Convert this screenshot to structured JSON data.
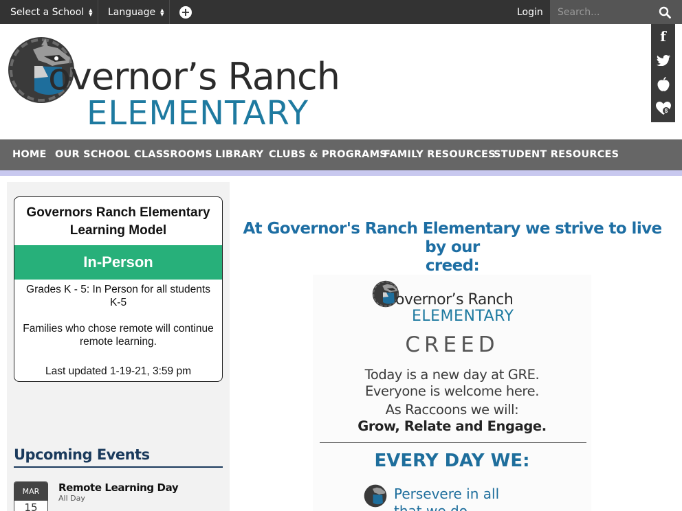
{
  "topbar": {
    "select_school": "Select a School",
    "language": "Language",
    "login": "Login",
    "search_placeholder": "Search..."
  },
  "social": [
    "facebook-icon",
    "twitter-icon",
    "peachjar-icon",
    "donate-icon"
  ],
  "logo": {
    "title": "overnor’s Ranch",
    "subtitle": "ELEMENTARY"
  },
  "nav": {
    "items": [
      "HOME",
      "OUR SCHOOL",
      "CLASSROOMS",
      "LIBRARY",
      "CLUBS & PROGRAMS",
      "FAMILY RESOURCES",
      "STUDENT RESOURCES"
    ]
  },
  "learning_model": {
    "title_line1": "Governors Ranch Elementary",
    "title_line2": "Learning Model",
    "status": "In-Person",
    "grades_line1": "Grades K - 5: In Person for all students",
    "grades_line2": "K-5",
    "remote_line1": "Families who chose remote will continue",
    "remote_line2": "remote learning.",
    "updated": "Last updated 1-19-21, 3:59 pm"
  },
  "events": {
    "heading": "Upcoming Events",
    "items": [
      {
        "month": "MAR",
        "day": "15",
        "title": "Remote Learning Day",
        "time": "All Day"
      }
    ]
  },
  "content": {
    "heading_line1": "At Governor's Ranch Elementary we strive to live by our",
    "heading_line2": "creed:"
  },
  "creed_image": {
    "logo_title": "overnor’s Ranch",
    "logo_subtitle": "ELEMENTARY",
    "creed_word": "CREED",
    "line1": "Today is a new day at GRE.",
    "line2": "Everyone is welcome here.",
    "line3": "As Raccoons we will:",
    "line4": "Grow, Relate and Engage.",
    "every_day": "EVERY DAY WE:",
    "item1_line1": "Persevere in all",
    "item1_line2": "that we do"
  },
  "colors": {
    "topbar": "#333333",
    "nav": "#666666",
    "nav_stripe": "#c8c8ef",
    "in_person_green": "#27b07a",
    "heading_blue": "#1d6ea3",
    "events_navy": "#1a3a5c"
  }
}
